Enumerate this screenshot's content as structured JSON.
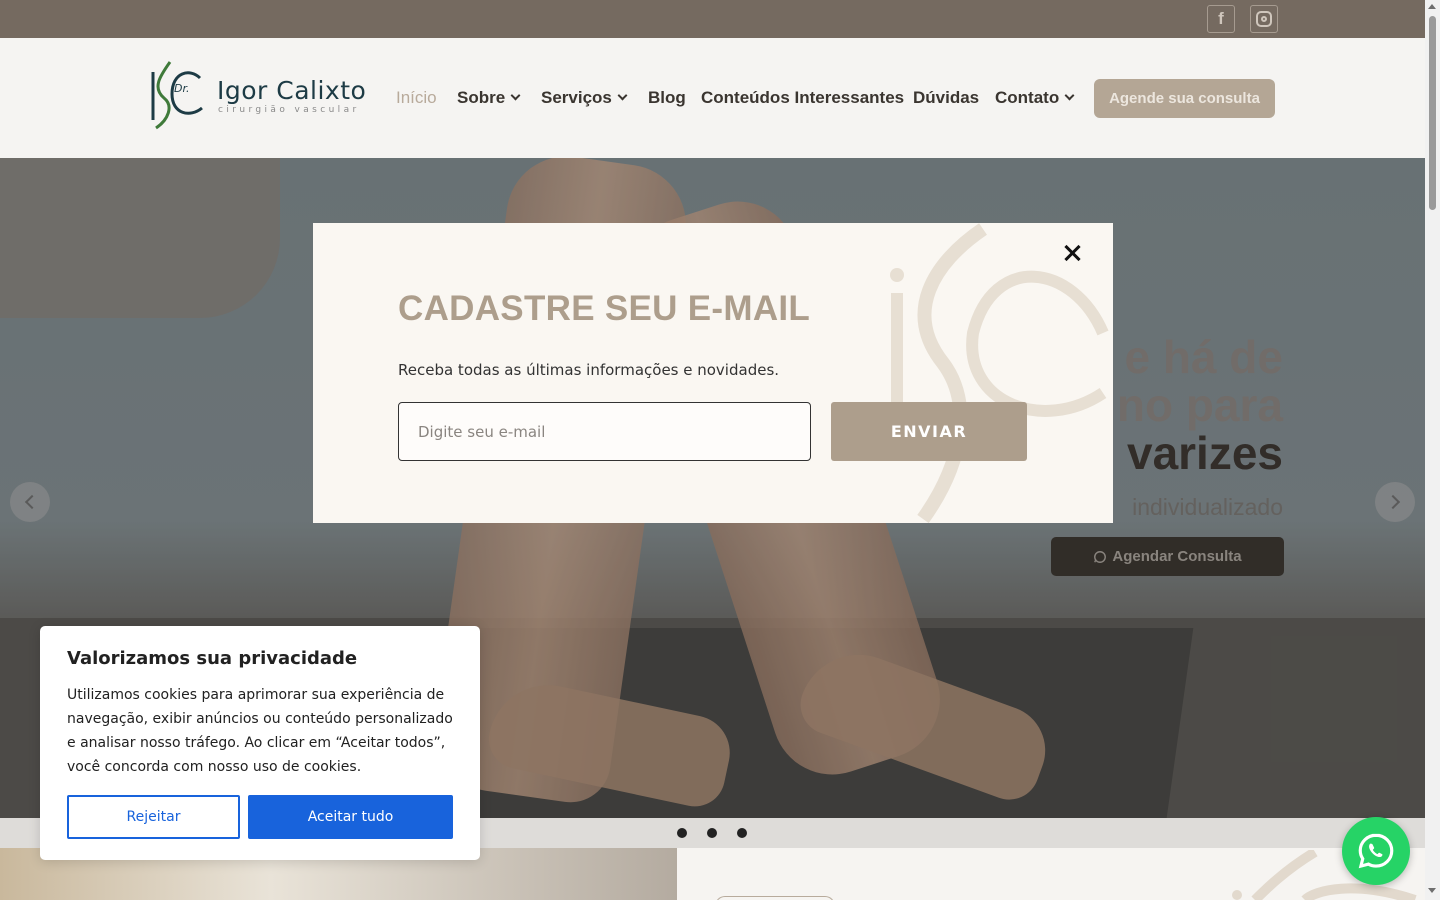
{
  "topbar": {
    "social": [
      {
        "name": "facebook-icon",
        "glyph": "f"
      },
      {
        "name": "instagram-icon",
        "glyph": ""
      }
    ]
  },
  "header": {
    "logo": {
      "mark": "Dr.",
      "title": "Igor Calixto",
      "subtitle": "cirurgião vascular"
    },
    "nav": [
      {
        "label": "Início",
        "active": true,
        "dropdown": false
      },
      {
        "label": "Sobre",
        "active": false,
        "dropdown": true
      },
      {
        "label": "Serviços",
        "active": false,
        "dropdown": true
      },
      {
        "label": "Blog",
        "active": false,
        "dropdown": false
      },
      {
        "label": "Conteúdos Interessantes",
        "active": false,
        "dropdown": false
      },
      {
        "label": "Dúvidas",
        "active": false,
        "dropdown": false
      },
      {
        "label": "Contato",
        "active": false,
        "dropdown": true
      }
    ],
    "cta_label": "Agende sua consulta"
  },
  "hero": {
    "lines": [
      "e há de",
      "no para",
      "varizes"
    ],
    "subtitle": "individualizado",
    "button_label": "Agendar Consulta",
    "slides": 3
  },
  "modal": {
    "title": "CADASTRE SEU E-MAIL",
    "description": "Receba todas as últimas informações e novidades.",
    "email_placeholder": "Digite seu e-mail",
    "submit_label": "ENVIAR"
  },
  "cookie": {
    "title": "Valorizamos sua privacidade",
    "body": "Utilizamos cookies para aprimorar sua experiência de navegação, exibir anúncios ou conteúdo personalizado e analisar nosso tráfego. Ao clicar em “Aceitar todos”, você concorda com nosso uso de cookies.",
    "reject_label": "Rejeitar",
    "accept_label": "Aceitar tudo"
  },
  "colors": {
    "brand": "#ad9e8c",
    "topbar": "#756a60",
    "cookie_accent": "#1863dc",
    "whatsapp": "#26d366"
  }
}
